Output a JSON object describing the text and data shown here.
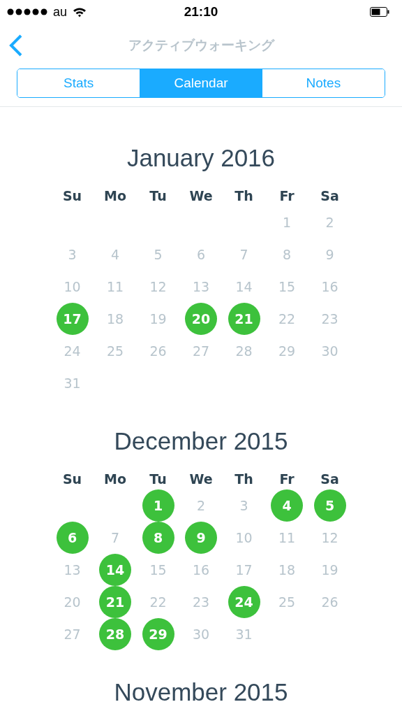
{
  "status_bar": {
    "carrier": "au",
    "time": "21:10"
  },
  "nav": {
    "title": "アクティブウォーキング"
  },
  "tabs": [
    {
      "label": "Stats",
      "selected": false
    },
    {
      "label": "Calendar",
      "selected": true
    },
    {
      "label": "Notes",
      "selected": false
    }
  ],
  "months": [
    {
      "title": "January 2016",
      "weekdays": [
        "Su",
        "Mo",
        "Tu",
        "We",
        "Th",
        "Fr",
        "Sa"
      ],
      "weeks": [
        [
          {
            "kind": "blank"
          },
          {
            "kind": "blank"
          },
          {
            "kind": "blank"
          },
          {
            "kind": "blank"
          },
          {
            "kind": "blank"
          },
          {
            "kind": "day",
            "day": "1",
            "done": false
          },
          {
            "kind": "day",
            "day": "2",
            "done": false
          }
        ],
        [
          {
            "kind": "day",
            "day": "3",
            "done": false
          },
          {
            "kind": "day",
            "day": "4",
            "done": false
          },
          {
            "kind": "day",
            "day": "5",
            "done": false
          },
          {
            "kind": "day",
            "day": "6",
            "done": false
          },
          {
            "kind": "day",
            "day": "7",
            "done": false
          },
          {
            "kind": "day",
            "day": "8",
            "done": false
          },
          {
            "kind": "day",
            "day": "9",
            "done": false
          }
        ],
        [
          {
            "kind": "day",
            "day": "10",
            "done": false
          },
          {
            "kind": "day",
            "day": "11",
            "done": false
          },
          {
            "kind": "day",
            "day": "12",
            "done": false
          },
          {
            "kind": "day",
            "day": "13",
            "done": false
          },
          {
            "kind": "day",
            "day": "14",
            "done": false
          },
          {
            "kind": "day",
            "day": "15",
            "done": false
          },
          {
            "kind": "day",
            "day": "16",
            "done": false
          }
        ],
        [
          {
            "kind": "day",
            "day": "17",
            "done": true
          },
          {
            "kind": "day",
            "day": "18",
            "done": false
          },
          {
            "kind": "day",
            "day": "19",
            "done": false
          },
          {
            "kind": "day",
            "day": "20",
            "done": true
          },
          {
            "kind": "day",
            "day": "21",
            "done": true
          },
          {
            "kind": "day",
            "day": "22",
            "done": false
          },
          {
            "kind": "day",
            "day": "23",
            "done": false
          }
        ],
        [
          {
            "kind": "day",
            "day": "24",
            "done": false
          },
          {
            "kind": "day",
            "day": "25",
            "done": false
          },
          {
            "kind": "day",
            "day": "26",
            "done": false
          },
          {
            "kind": "day",
            "day": "27",
            "done": false
          },
          {
            "kind": "day",
            "day": "28",
            "done": false
          },
          {
            "kind": "day",
            "day": "29",
            "done": false
          },
          {
            "kind": "day",
            "day": "30",
            "done": false
          }
        ],
        [
          {
            "kind": "day",
            "day": "31",
            "done": false
          }
        ]
      ]
    },
    {
      "title": "December 2015",
      "weekdays": [
        "Su",
        "Mo",
        "Tu",
        "We",
        "Th",
        "Fr",
        "Sa"
      ],
      "weeks": [
        [
          {
            "kind": "blank"
          },
          {
            "kind": "blank"
          },
          {
            "kind": "day",
            "day": "1",
            "done": true
          },
          {
            "kind": "day",
            "day": "2",
            "done": false
          },
          {
            "kind": "day",
            "day": "3",
            "done": false
          },
          {
            "kind": "day",
            "day": "4",
            "done": true
          },
          {
            "kind": "day",
            "day": "5",
            "done": true
          }
        ],
        [
          {
            "kind": "day",
            "day": "6",
            "done": true
          },
          {
            "kind": "day",
            "day": "7",
            "done": false
          },
          {
            "kind": "day",
            "day": "8",
            "done": true
          },
          {
            "kind": "day",
            "day": "9",
            "done": true
          },
          {
            "kind": "day",
            "day": "10",
            "done": false
          },
          {
            "kind": "day",
            "day": "11",
            "done": false
          },
          {
            "kind": "day",
            "day": "12",
            "done": false
          }
        ],
        [
          {
            "kind": "day",
            "day": "13",
            "done": false
          },
          {
            "kind": "day",
            "day": "14",
            "done": true
          },
          {
            "kind": "day",
            "day": "15",
            "done": false
          },
          {
            "kind": "day",
            "day": "16",
            "done": false
          },
          {
            "kind": "day",
            "day": "17",
            "done": false
          },
          {
            "kind": "day",
            "day": "18",
            "done": false
          },
          {
            "kind": "day",
            "day": "19",
            "done": false
          }
        ],
        [
          {
            "kind": "day",
            "day": "20",
            "done": false
          },
          {
            "kind": "day",
            "day": "21",
            "done": true
          },
          {
            "kind": "day",
            "day": "22",
            "done": false
          },
          {
            "kind": "day",
            "day": "23",
            "done": false
          },
          {
            "kind": "day",
            "day": "24",
            "done": true
          },
          {
            "kind": "day",
            "day": "25",
            "done": false
          },
          {
            "kind": "day",
            "day": "26",
            "done": false
          }
        ],
        [
          {
            "kind": "day",
            "day": "27",
            "done": false
          },
          {
            "kind": "day",
            "day": "28",
            "done": true
          },
          {
            "kind": "day",
            "day": "29",
            "done": true
          },
          {
            "kind": "day",
            "day": "30",
            "done": false
          },
          {
            "kind": "day",
            "day": "31",
            "done": false
          }
        ]
      ]
    },
    {
      "title": "November 2015"
    }
  ]
}
